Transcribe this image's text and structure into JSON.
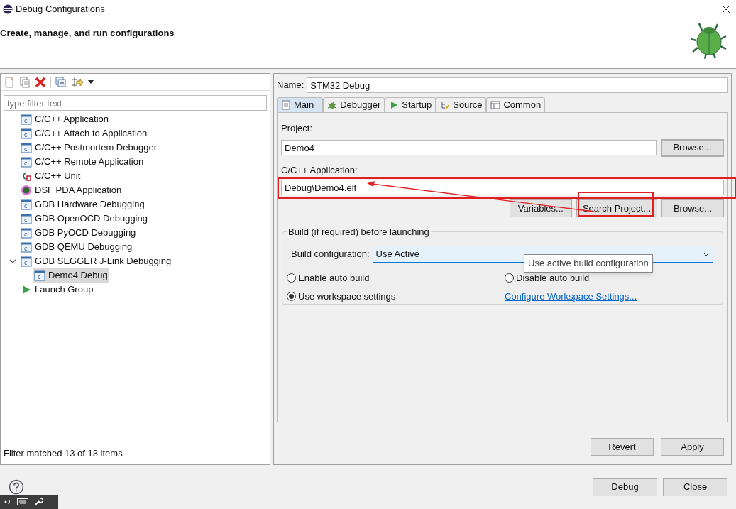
{
  "window": {
    "title": "Debug Configurations"
  },
  "header": {
    "title": "Create, manage, and run configurations"
  },
  "left_panel": {
    "filter": {
      "placeholder": "type filter text"
    },
    "tree": [
      {
        "label": "C/C++ Application",
        "kind": "c",
        "selected": false
      },
      {
        "label": "C/C++ Attach to Application",
        "kind": "c",
        "selected": false
      },
      {
        "label": "C/C++ Postmortem Debugger",
        "kind": "c",
        "selected": false
      },
      {
        "label": "C/C++ Remote Application",
        "kind": "c",
        "selected": false
      },
      {
        "label": "C/C++ Unit",
        "kind": "unit",
        "selected": false
      },
      {
        "label": "DSF PDA Application",
        "kind": "dsf",
        "selected": false
      },
      {
        "label": "GDB Hardware Debugging",
        "kind": "c",
        "selected": false
      },
      {
        "label": "GDB OpenOCD Debugging",
        "kind": "c",
        "selected": false
      },
      {
        "label": "GDB PyOCD Debugging",
        "kind": "c",
        "selected": false
      },
      {
        "label": "GDB QEMU Debugging",
        "kind": "c",
        "selected": false
      },
      {
        "label": "GDB SEGGER J-Link Debugging",
        "kind": "c",
        "selected": false,
        "expanded": true,
        "children": [
          {
            "label": "Demo4 Debug",
            "kind": "c",
            "selected": true
          }
        ]
      },
      {
        "label": "Launch Group",
        "kind": "launch",
        "selected": false
      }
    ],
    "status": "Filter matched 13 of 13 items"
  },
  "config": {
    "name_label": "Name:",
    "name": "STM32 Debug",
    "tabs": [
      {
        "label": "Main",
        "kind": "main",
        "selected": true
      },
      {
        "label": "Debugger",
        "kind": "debugger",
        "selected": false
      },
      {
        "label": "Startup",
        "kind": "startup",
        "selected": false
      },
      {
        "label": "Source",
        "kind": "source",
        "selected": false
      },
      {
        "label": "Common",
        "kind": "common",
        "selected": false
      }
    ],
    "project_label": "Project:",
    "project": "Demo4",
    "project_browse": "Browse...",
    "app_label": "C/C++ Application:",
    "app": "Debug\\Demo4.elf",
    "app_buttons": [
      "Variables...",
      "Search Project...",
      "Browse..."
    ],
    "build_group": "Build (if required) before launching",
    "build_config_label": "Build configuration:",
    "build_config": "Use Active",
    "tooltip": "Use active build configuration",
    "radios": [
      {
        "label": "Enable auto build",
        "selected": false
      },
      {
        "label": "Disable auto build",
        "selected": false
      },
      {
        "label": "Use workspace settings",
        "selected": true
      }
    ],
    "link": "Configure Workspace Settings...",
    "buttons": [
      "Revert",
      "Apply"
    ]
  },
  "footer_buttons": [
    "Debug",
    "Close"
  ]
}
